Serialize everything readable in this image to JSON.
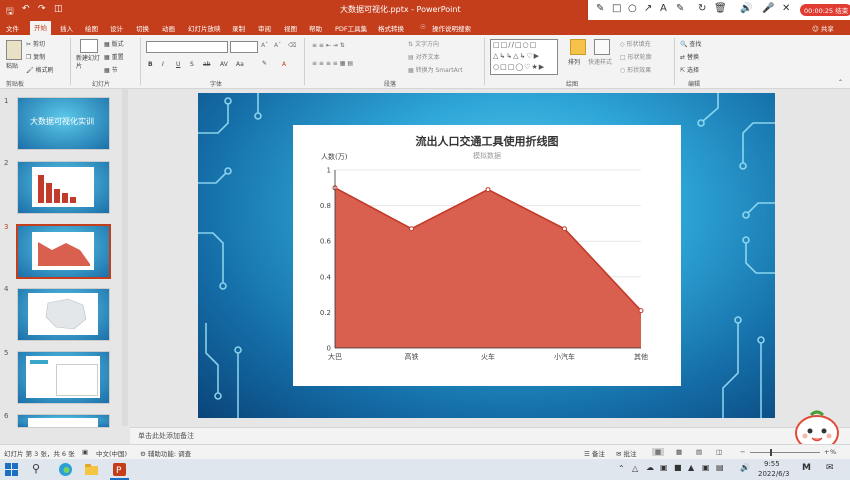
{
  "window": {
    "title": "大数据可视化.pptx - PowerPoint"
  },
  "quick_access": [
    "save-icon",
    "undo-icon",
    "redo-icon",
    "start-slideshow-icon"
  ],
  "tabs": [
    {
      "label": "文件"
    },
    {
      "label": "开始"
    },
    {
      "label": "插入"
    },
    {
      "label": "绘图"
    },
    {
      "label": "设计"
    },
    {
      "label": "切换"
    },
    {
      "label": "动画"
    },
    {
      "label": "幻灯片放映"
    },
    {
      "label": "录制"
    },
    {
      "label": "审阅"
    },
    {
      "label": "视图"
    },
    {
      "label": "帮助"
    },
    {
      "label": "PDF工具集"
    },
    {
      "label": "格式转换"
    },
    {
      "label": "操作说明搜索"
    }
  ],
  "share": {
    "label": "共享"
  },
  "recording": {
    "time": "00:00:25",
    "label": "结束"
  },
  "ribbon": {
    "clipboard": {
      "paste": "粘贴",
      "cut": "剪切",
      "copy": "复制",
      "format_painter": "格式刷",
      "group": "剪贴板"
    },
    "slides": {
      "new_slide": "新建幻灯片",
      "layout": "版式",
      "reset": "重置",
      "section": "节",
      "group": "幻灯片"
    },
    "font": {
      "group": "字体",
      "bold": "B",
      "italic": "I",
      "underline": "U",
      "strike": "S",
      "ab": "ab",
      "av": "AV",
      "aa": "Aa",
      "a": "A"
    },
    "paragraph": {
      "text_direction": "文字方向",
      "align_text": "对齐文本",
      "smartart": "转换为 SmartArt",
      "group": "段落"
    },
    "drawing": {
      "arrange": "排列",
      "quick_styles": "快速样式",
      "shape_fill": "形状填充",
      "shape_outline": "形状轮廓",
      "shape_effects": "形状效果",
      "group": "绘图"
    },
    "editing": {
      "find": "查找",
      "replace": "替换",
      "select": "选择",
      "group": "编辑"
    }
  },
  "thumbnails": [
    {
      "num": "1",
      "title": "大数据可视化实训"
    },
    {
      "num": "2"
    },
    {
      "num": "3"
    },
    {
      "num": "4"
    },
    {
      "num": "5"
    },
    {
      "num": "6"
    }
  ],
  "notes": {
    "placeholder": "单击此处添加备注"
  },
  "status": {
    "slide_info": "幻灯片 第 3 张，共 6 张",
    "language": "中文(中国)",
    "accessibility": "辅助功能: 调查",
    "notes_btn": "备注",
    "comments_btn": "批注",
    "zoom": "%"
  },
  "taskbar": {
    "time": "9:55",
    "date": "2022/6/3"
  },
  "chart_data": {
    "type": "area",
    "title": "流出人口交通工具使用折线图",
    "subtitle": "模拟数据",
    "ylabel": "人数(万)",
    "categories": [
      "大巴",
      "高铁",
      "火车",
      "小汽车",
      "其他"
    ],
    "values": [
      0.9,
      0.67,
      0.89,
      0.67,
      0.21
    ],
    "yticks": [
      "0",
      "0.2",
      "0.4",
      "0.6",
      "0.8",
      "1"
    ],
    "ylim": [
      0,
      1
    ],
    "grid": true,
    "fill_color": "#d9604f",
    "line_color": "#c23a2a"
  }
}
